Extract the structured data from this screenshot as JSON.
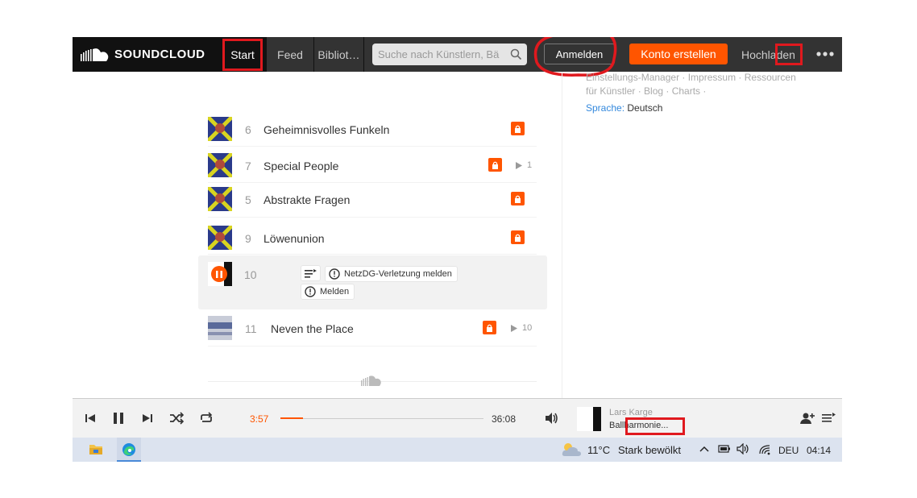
{
  "header": {
    "logo_text": "SOUNDCLOUD",
    "nav_start": "Start",
    "nav_feed": "Feed",
    "nav_library": "Bibliot…",
    "search_placeholder": "Suche nach Künstlern, Bä",
    "login_label": "Anmelden",
    "create_account_label": "Konto erstellen",
    "upload_label": "Hochladen"
  },
  "sidebar": {
    "links_line1": "Einstellungs-Manager · Impressum · Ressourcen",
    "links_line2": "für Künstler · Blog · Charts ·",
    "language_label": "Sprache:",
    "language_value": "Deutsch"
  },
  "tracks": [
    {
      "num": "6",
      "title": "Geheimnisvolles Funkeln",
      "plays": ""
    },
    {
      "num": "7",
      "title": "Special People",
      "plays": "1"
    },
    {
      "num": "5",
      "title": "Abstrakte Fragen",
      "plays": ""
    },
    {
      "num": "9",
      "title": "Löwenunion",
      "plays": ""
    },
    {
      "num": "10",
      "title": "",
      "plays": ""
    },
    {
      "num": "11",
      "title": "Neven the Place",
      "plays": "10"
    }
  ],
  "active_actions": {
    "netzdg_label": "NetzDG-Verletzung melden",
    "report_label": "Melden"
  },
  "player": {
    "elapsed": "3:57",
    "duration": "36:08",
    "progress_fraction": 0.11,
    "artist": "Lars Karge",
    "title": "Ballharmonie..."
  },
  "taskbar": {
    "temperature": "11°C",
    "weather": "Stark bewölkt",
    "language": "DEU",
    "time": "04:14"
  },
  "colors": {
    "accent": "#ff5500",
    "header_bg": "#333333",
    "annotation_red": "#e0191e"
  }
}
